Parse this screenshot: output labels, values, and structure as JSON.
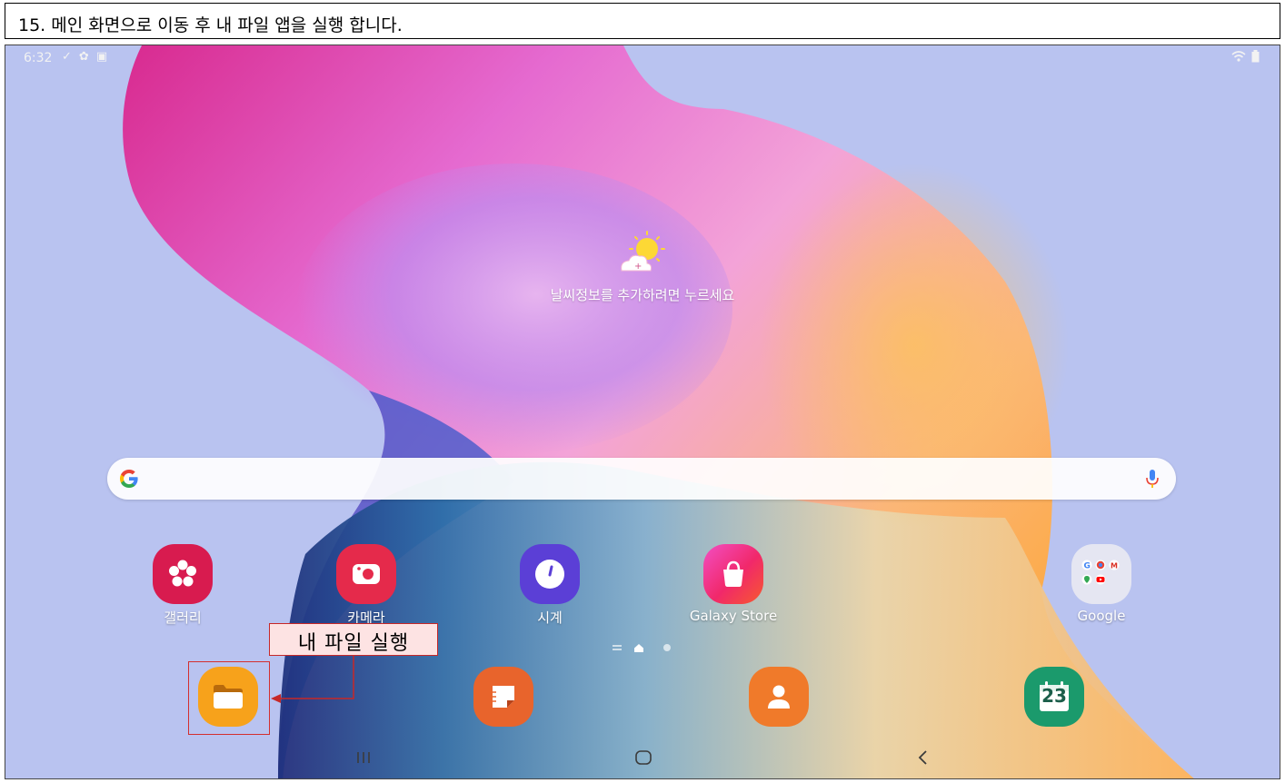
{
  "caption": {
    "text": "15. 메인 화면으로 이동 후 내 파일 앱을 실행 합니다."
  },
  "statusbar": {
    "time": "6:32",
    "left_icons": [
      "check-icon",
      "gear-icon",
      "image-icon"
    ],
    "right_icons": [
      "wifi-icon",
      "battery-icon"
    ]
  },
  "weather": {
    "prompt": "날씨정보를 추가하려면 누르세요",
    "icon": "sun-cloud-icon"
  },
  "search": {
    "logo": "google-g-icon",
    "mic": "mic-icon"
  },
  "apps": [
    {
      "label": "갤러리",
      "icon": "gallery-icon",
      "color": "#d81b4f"
    },
    {
      "label": "카메라",
      "icon": "camera-icon",
      "color": "#e52a4b"
    },
    {
      "label": "시계",
      "icon": "clock-icon",
      "color": "#5b3fd6"
    },
    {
      "label": "Galaxy Store",
      "icon": "galaxy-store-icon",
      "color": "#e0246d"
    },
    {
      "label": "Google",
      "icon": "google-folder-icon",
      "color": "#e8e8ec"
    }
  ],
  "dock": [
    {
      "name": "my-files",
      "icon": "folder-icon",
      "color": "#f7a21b"
    },
    {
      "name": "notes",
      "icon": "notes-icon",
      "color": "#e8642c"
    },
    {
      "name": "contacts",
      "icon": "contacts-icon",
      "color": "#f07a2a"
    },
    {
      "name": "calendar",
      "icon": "calendar-icon",
      "color": "#1b9a6c",
      "date": "23"
    }
  ],
  "callout": {
    "text": "내 파일 실행",
    "color": "#c62828"
  },
  "navbar": {
    "buttons": [
      "recents-icon",
      "home-icon",
      "back-icon"
    ]
  }
}
